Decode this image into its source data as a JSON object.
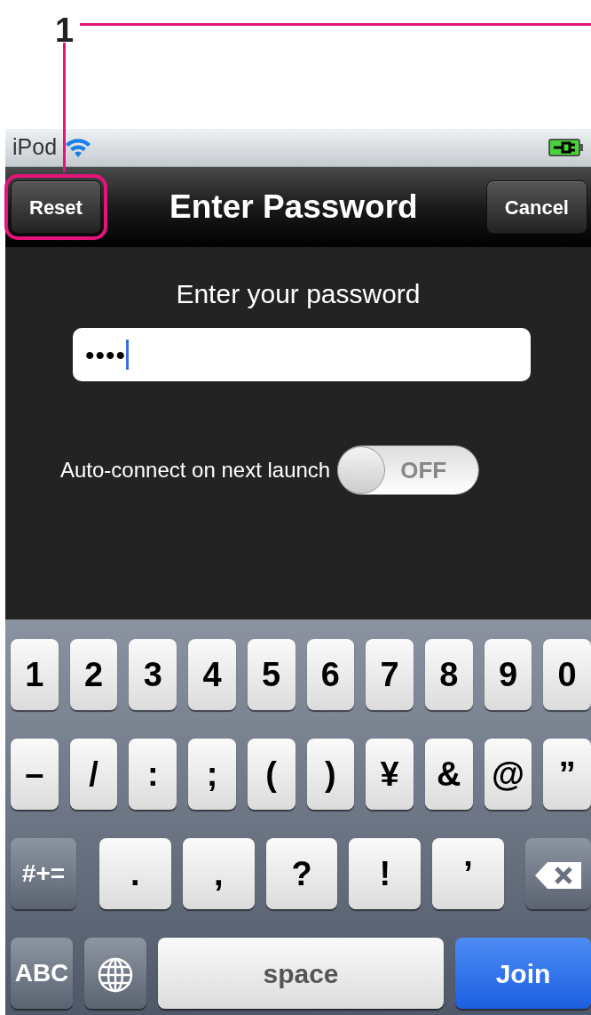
{
  "callout": {
    "number": "1"
  },
  "status_bar": {
    "carrier": "iPod"
  },
  "nav_bar": {
    "left_button": {
      "label": "Reset",
      "highlighted": true
    },
    "title": "Enter Password",
    "right_button": {
      "label": "Cancel",
      "highlighted": false
    }
  },
  "form": {
    "prompt": "Enter your password",
    "password_value": "••••",
    "auto_connect": {
      "label": "Auto-connect on next launch",
      "on": false,
      "switch_text": "OFF"
    }
  },
  "keyboard": {
    "number_keys": [
      {
        "kind": "char",
        "label": "1"
      },
      {
        "kind": "char",
        "label": "2"
      },
      {
        "kind": "char",
        "label": "3"
      },
      {
        "kind": "char",
        "label": "4"
      },
      {
        "kind": "char",
        "label": "5"
      },
      {
        "kind": "char",
        "label": "6"
      },
      {
        "kind": "char",
        "label": "7"
      },
      {
        "kind": "char",
        "label": "8"
      },
      {
        "kind": "char",
        "label": "9"
      },
      {
        "kind": "char",
        "label": "0"
      }
    ],
    "symbol_keys": [
      {
        "kind": "char",
        "label": "–"
      },
      {
        "kind": "char",
        "label": "/"
      },
      {
        "kind": "char",
        "label": ":"
      },
      {
        "kind": "char",
        "label": ";"
      },
      {
        "kind": "char",
        "label": "("
      },
      {
        "kind": "char",
        "label": ")"
      },
      {
        "kind": "char",
        "label": "¥"
      },
      {
        "kind": "char",
        "label": "&"
      },
      {
        "kind": "char",
        "label": "@"
      },
      {
        "kind": "char",
        "label": "”"
      }
    ],
    "punctuation_keys": [
      {
        "kind": "mode",
        "label": "#+="
      },
      {
        "kind": "char",
        "label": "."
      },
      {
        "kind": "char",
        "label": ","
      },
      {
        "kind": "char",
        "label": "?"
      },
      {
        "kind": "char",
        "label": "!"
      },
      {
        "kind": "char",
        "label": "’"
      },
      {
        "kind": "delete"
      }
    ],
    "bottom_keys": [
      {
        "kind": "mode",
        "label": "ABC"
      },
      {
        "kind": "globe"
      },
      {
        "kind": "space",
        "label": "space"
      },
      {
        "kind": "action",
        "label": "Join"
      }
    ]
  }
}
